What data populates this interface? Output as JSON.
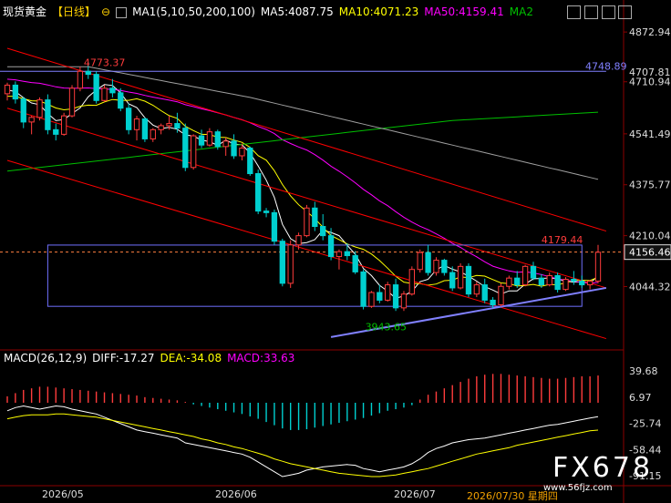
{
  "header": {
    "instrument": "现货黄金",
    "period": "【日线】",
    "ma_label": "MA1(5,10,50,200,100)",
    "ma5": "MA5:4087.75",
    "ma10": "MA10:4071.23",
    "ma50": "MA50:4159.41",
    "ma2": "MA2"
  },
  "macd_header": {
    "label": "MACD(26,12,9)",
    "diff": "DIFF:-17.27",
    "dea": "DEA:-34.08",
    "macd": "MACD:33.63"
  },
  "colors": {
    "up": "#ff3c3c",
    "down": "#00d0d0",
    "ma5": "#ffffff",
    "ma10": "#ffff00",
    "ma50": "#ff00ff",
    "ma200": "#00c000",
    "ma100": "#a0a0a0",
    "channel": "#ff0000",
    "support": "#8080ff",
    "box": "#7070ff"
  },
  "icons": [
    "chart-type-icon",
    "settings-icon",
    "minimize-icon",
    "close-icon",
    "scroll-right-icon"
  ],
  "chart_data": [
    {
      "type": "candlestick",
      "ylim": [
        3850,
        4900
      ],
      "y_ticks": [
        "4872.94",
        "4710.94",
        "4541.49",
        "4375.77",
        "4210.04",
        "4044.32"
      ],
      "x_ticks": [
        "2026/05",
        "2026/06",
        "2026/07"
      ],
      "cursor_date": "2026/07/30 星期四",
      "current_price": "4156.46",
      "annotations": {
        "high": "4773.37",
        "low": "3943.65",
        "recent_high": "4179.44",
        "level": "4748.89",
        "level_right": "4707.81"
      },
      "candles": [
        [
          4672,
          4708,
          4650,
          4700
        ],
        [
          4700,
          4712,
          4640,
          4655
        ],
        [
          4655,
          4662,
          4560,
          4580
        ],
        [
          4580,
          4600,
          4540,
          4595
        ],
        [
          4595,
          4660,
          4585,
          4652
        ],
        [
          4652,
          4670,
          4540,
          4555
        ],
        [
          4555,
          4575,
          4520,
          4540
        ],
        [
          4540,
          4610,
          4535,
          4600
        ],
        [
          4600,
          4700,
          4595,
          4690
        ],
        [
          4690,
          4760,
          4680,
          4745
        ],
        [
          4745,
          4775,
          4720,
          4735
        ],
        [
          4735,
          4745,
          4640,
          4650
        ],
        [
          4650,
          4700,
          4645,
          4690
        ],
        [
          4690,
          4720,
          4660,
          4675
        ],
        [
          4675,
          4690,
          4615,
          4625
        ],
        [
          4625,
          4640,
          4540,
          4555
        ],
        [
          4555,
          4600,
          4520,
          4590
        ],
        [
          4590,
          4595,
          4515,
          4525
        ],
        [
          4525,
          4560,
          4515,
          4555
        ],
        [
          4555,
          4575,
          4540,
          4568
        ],
        [
          4568,
          4600,
          4555,
          4575
        ],
        [
          4575,
          4610,
          4545,
          4560
        ],
        [
          4560,
          4575,
          4420,
          4432
        ],
        [
          4432,
          4540,
          4425,
          4535
        ],
        [
          4535,
          4555,
          4495,
          4505
        ],
        [
          4505,
          4560,
          4500,
          4548
        ],
        [
          4548,
          4555,
          4490,
          4500
        ],
        [
          4500,
          4530,
          4470,
          4518
        ],
        [
          4518,
          4540,
          4460,
          4470
        ],
        [
          4470,
          4510,
          4455,
          4495
        ],
        [
          4495,
          4500,
          4405,
          4412
        ],
        [
          4412,
          4425,
          4280,
          4290
        ],
        [
          4290,
          4300,
          4270,
          4285
        ],
        [
          4285,
          4295,
          4180,
          4192
        ],
        [
          4192,
          4200,
          4045,
          4055
        ],
        [
          4055,
          4195,
          4040,
          4180
        ],
        [
          4180,
          4220,
          4165,
          4210
        ],
        [
          4210,
          4310,
          4205,
          4300
        ],
        [
          4300,
          4320,
          4225,
          4240
        ],
        [
          4240,
          4280,
          4195,
          4210
        ],
        [
          4210,
          4235,
          4130,
          4142
        ],
        [
          4142,
          4165,
          4100,
          4158
        ],
        [
          4158,
          4185,
          4130,
          4145
        ],
        [
          4145,
          4160,
          4085,
          4092
        ],
        [
          4092,
          4100,
          3970,
          3980
        ],
        [
          3980,
          4030,
          3975,
          4025
        ],
        [
          4025,
          4050,
          3990,
          4000
        ],
        [
          4000,
          4060,
          3995,
          4050
        ],
        [
          4050,
          4070,
          3965,
          3975
        ],
        [
          3975,
          4030,
          3965,
          4020
        ],
        [
          4020,
          4110,
          4015,
          4100
        ],
        [
          4100,
          4165,
          4090,
          4155
        ],
        [
          4155,
          4180,
          4080,
          4090
        ],
        [
          4090,
          4140,
          4080,
          4130
        ],
        [
          4130,
          4135,
          4080,
          4090
        ],
        [
          4090,
          4110,
          4030,
          4040
        ],
        [
          4040,
          4120,
          4035,
          4110
        ],
        [
          4110,
          4120,
          4010,
          4020
        ],
        [
          4020,
          4060,
          4010,
          4050
        ],
        [
          4050,
          4070,
          3990,
          4000
        ],
        [
          4000,
          4010,
          3975,
          3985
        ],
        [
          3985,
          4055,
          3980,
          4045
        ],
        [
          4045,
          4080,
          4035,
          4072
        ],
        [
          4072,
          4095,
          4040,
          4050
        ],
        [
          4050,
          4115,
          4045,
          4110
        ],
        [
          4110,
          4125,
          4065,
          4072
        ],
        [
          4072,
          4085,
          4040,
          4050
        ],
        [
          4050,
          4090,
          4045,
          4080
        ],
        [
          4080,
          4090,
          4025,
          4035
        ],
        [
          4035,
          4075,
          4030,
          4068
        ],
        [
          4068,
          4095,
          4050,
          4062
        ],
        [
          4062,
          4080,
          4040,
          4050
        ],
        [
          4050,
          4065,
          4035,
          4062
        ],
        [
          4062,
          4180,
          4055,
          4156
        ]
      ]
    },
    {
      "type": "bar",
      "title": "MACD(26,12,9)",
      "ylim": [
        -100,
        50
      ],
      "y_ticks": [
        "39.68",
        "6.97",
        "-25.74",
        "-58.44",
        "-91.15"
      ],
      "series": [
        {
          "name": "MACD",
          "values": [
            8,
            12,
            16,
            18,
            20,
            20,
            19,
            18,
            17,
            16,
            15,
            14,
            13,
            12,
            11,
            10,
            9,
            7,
            6,
            5,
            4,
            3,
            1,
            -2,
            -4,
            -6,
            -8,
            -10,
            -12,
            -14,
            -17,
            -20,
            -24,
            -28,
            -32,
            -34,
            -34,
            -33,
            -31,
            -29,
            -27,
            -25,
            -23,
            -21,
            -19,
            -16,
            -13,
            -10,
            -8,
            -6,
            -3,
            4,
            10,
            14,
            18,
            22,
            26,
            30,
            33,
            35,
            36,
            36,
            35,
            34,
            33,
            32,
            31,
            30,
            30,
            31,
            32,
            33,
            33,
            34
          ]
        },
        {
          "name": "DIFF",
          "values": [
            -10,
            -6,
            -4,
            -6,
            -8,
            -6,
            -4,
            -5,
            -8,
            -10,
            -12,
            -14,
            -18,
            -22,
            -26,
            -30,
            -34,
            -36,
            -38,
            -40,
            -42,
            -44,
            -50,
            -52,
            -54,
            -56,
            -58,
            -60,
            -62,
            -64,
            -68,
            -74,
            -80,
            -86,
            -92,
            -90,
            -88,
            -84,
            -82,
            -80,
            -79,
            -78,
            -77,
            -78,
            -82,
            -84,
            -86,
            -84,
            -82,
            -80,
            -76,
            -70,
            -62,
            -57,
            -54,
            -50,
            -48,
            -46,
            -45,
            -44,
            -42,
            -40,
            -38,
            -36,
            -34,
            -32,
            -30,
            -28,
            -27,
            -25,
            -23,
            -21,
            -19,
            -17.27
          ]
        },
        {
          "name": "DEA",
          "values": [
            -20,
            -18,
            -16,
            -15,
            -15,
            -15,
            -14,
            -14,
            -15,
            -16,
            -17,
            -18,
            -20,
            -22,
            -24,
            -26,
            -28,
            -30,
            -32,
            -34,
            -36,
            -38,
            -40,
            -42,
            -45,
            -47,
            -50,
            -52,
            -55,
            -57,
            -60,
            -63,
            -66,
            -70,
            -73,
            -76,
            -78,
            -80,
            -82,
            -84,
            -86,
            -88,
            -89,
            -90,
            -91,
            -92,
            -92,
            -91,
            -90,
            -88,
            -86,
            -84,
            -82,
            -79,
            -76,
            -73,
            -70,
            -67,
            -64,
            -62,
            -60,
            -58,
            -56,
            -53,
            -51,
            -49,
            -47,
            -45,
            -43,
            -41,
            -39,
            -37,
            -35,
            -34.08
          ]
        }
      ]
    }
  ]
}
